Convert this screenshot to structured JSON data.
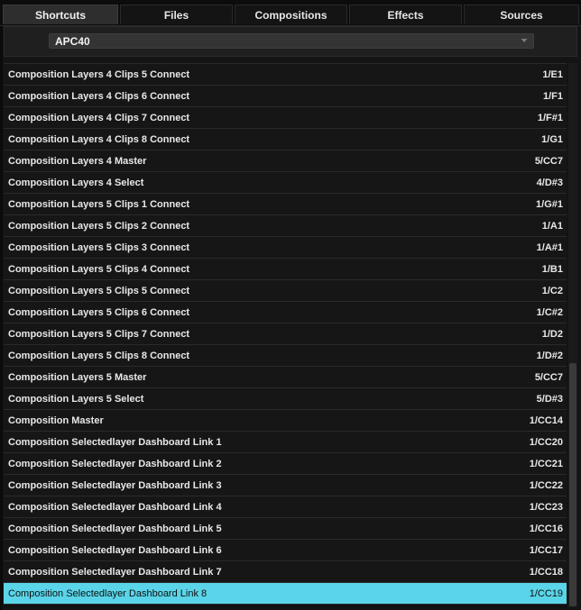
{
  "tabs": [
    {
      "label": "Shortcuts",
      "active": true
    },
    {
      "label": "Files",
      "active": false
    },
    {
      "label": "Compositions",
      "active": false
    },
    {
      "label": "Effects",
      "active": false
    },
    {
      "label": "Sources",
      "active": false
    }
  ],
  "device_select": {
    "value": "APC40"
  },
  "shortcuts": [
    {
      "name": "Composition Layers 4 Clips 5 Connect",
      "key": "1/E1"
    },
    {
      "name": "Composition Layers 4 Clips 6 Connect",
      "key": "1/F1"
    },
    {
      "name": "Composition Layers 4 Clips 7 Connect",
      "key": "1/F#1"
    },
    {
      "name": "Composition Layers 4 Clips 8 Connect",
      "key": "1/G1"
    },
    {
      "name": "Composition Layers 4 Master",
      "key": "5/CC7"
    },
    {
      "name": "Composition Layers 4 Select",
      "key": "4/D#3"
    },
    {
      "name": "Composition Layers 5 Clips 1 Connect",
      "key": "1/G#1"
    },
    {
      "name": "Composition Layers 5 Clips 2 Connect",
      "key": "1/A1"
    },
    {
      "name": "Composition Layers 5 Clips 3 Connect",
      "key": "1/A#1"
    },
    {
      "name": "Composition Layers 5 Clips 4 Connect",
      "key": "1/B1"
    },
    {
      "name": "Composition Layers 5 Clips 5 Connect",
      "key": "1/C2"
    },
    {
      "name": "Composition Layers 5 Clips 6 Connect",
      "key": "1/C#2"
    },
    {
      "name": "Composition Layers 5 Clips 7 Connect",
      "key": "1/D2"
    },
    {
      "name": "Composition Layers 5 Clips 8 Connect",
      "key": "1/D#2"
    },
    {
      "name": "Composition Layers 5 Master",
      "key": "5/CC7"
    },
    {
      "name": "Composition Layers 5 Select",
      "key": "5/D#3"
    },
    {
      "name": "Composition Master",
      "key": "1/CC14"
    },
    {
      "name": "Composition Selectedlayer Dashboard Link 1",
      "key": "1/CC20"
    },
    {
      "name": "Composition Selectedlayer Dashboard Link 2",
      "key": "1/CC21"
    },
    {
      "name": "Composition Selectedlayer Dashboard Link 3",
      "key": "1/CC22"
    },
    {
      "name": "Composition Selectedlayer Dashboard Link 4",
      "key": "1/CC23"
    },
    {
      "name": "Composition Selectedlayer Dashboard Link 5",
      "key": "1/CC16"
    },
    {
      "name": "Composition Selectedlayer Dashboard Link 6",
      "key": "1/CC17"
    },
    {
      "name": "Composition Selectedlayer Dashboard Link 7",
      "key": "1/CC18"
    },
    {
      "name": "Composition Selectedlayer Dashboard Link 8",
      "key": "1/CC19",
      "selected": true
    }
  ],
  "colors": {
    "selection": "#5ad4e8",
    "background": "#141414"
  },
  "icons": {
    "dropdown": "chevron-down-icon"
  }
}
